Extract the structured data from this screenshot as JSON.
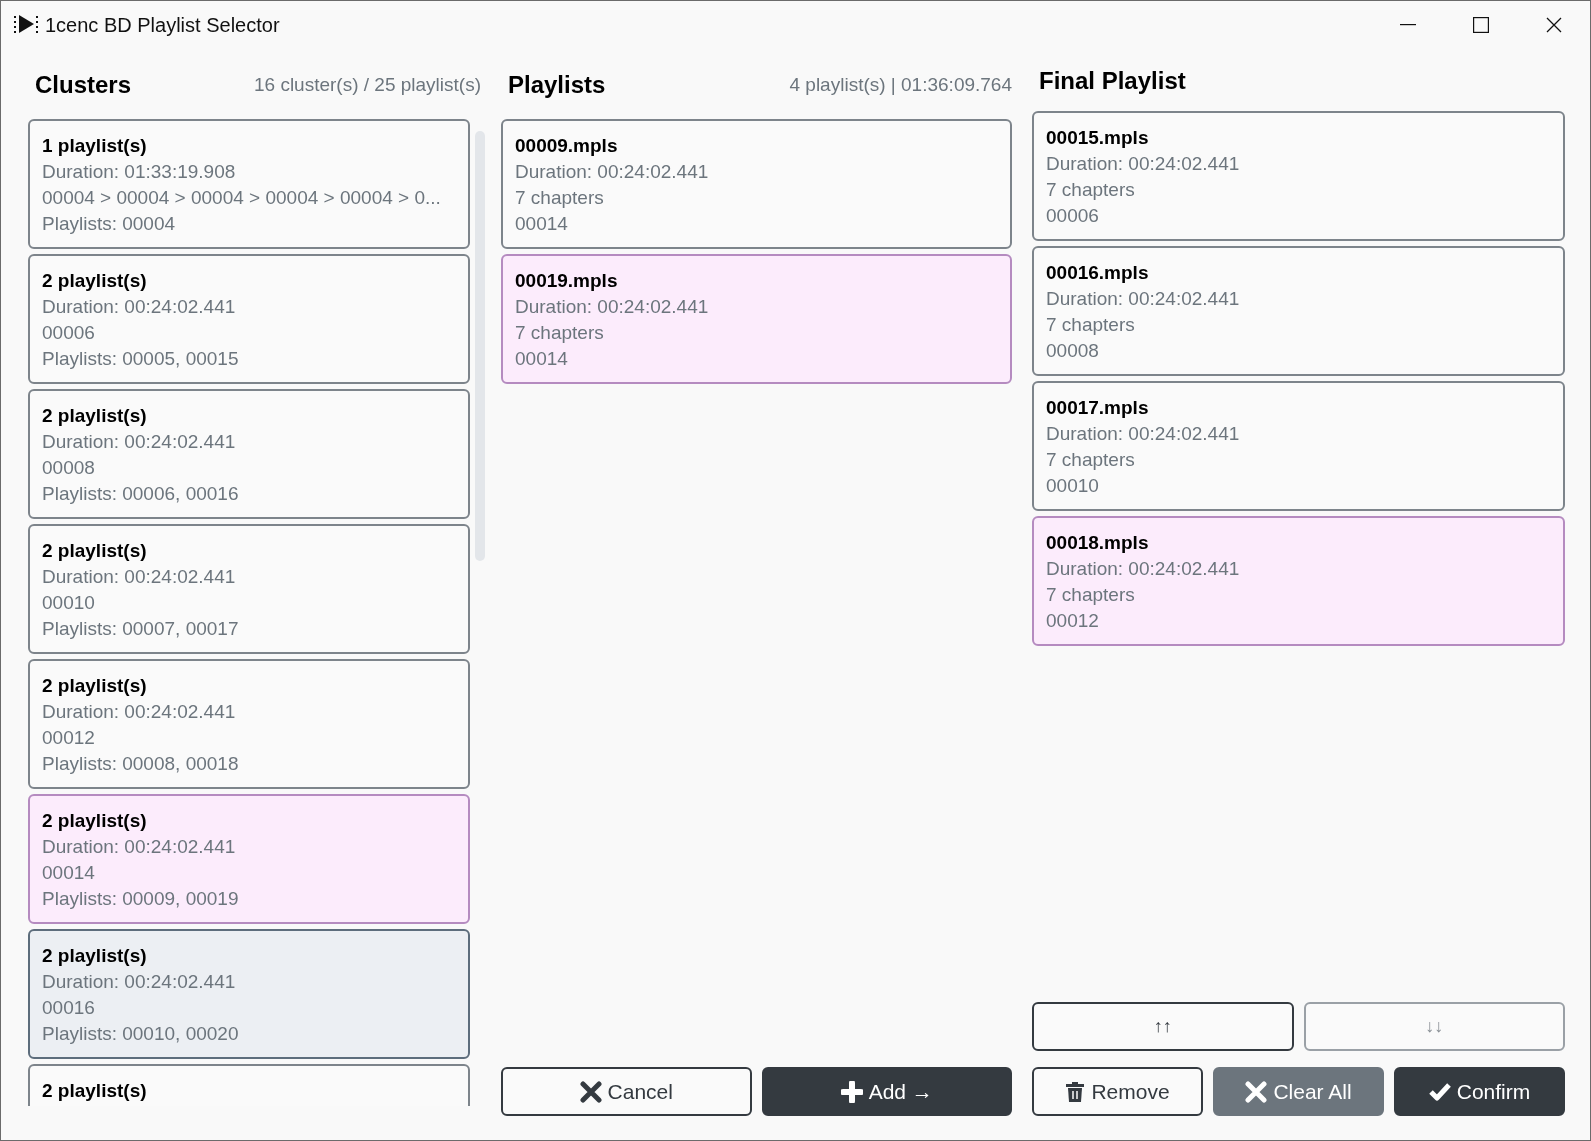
{
  "window": {
    "title": "1cenc BD Playlist Selector"
  },
  "clusters": {
    "heading": "Clusters",
    "summary": "16 cluster(s) / 25 playlist(s)",
    "items": [
      {
        "title": "1 playlist(s)",
        "lines": [
          "Duration: 01:33:19.908",
          "00004 > 00004 > 00004 > 00004 > 00004 > 0...",
          "Playlists: 00004"
        ],
        "selected": false,
        "hovered": false
      },
      {
        "title": "2 playlist(s)",
        "lines": [
          "Duration: 00:24:02.441",
          "00006",
          "Playlists: 00005, 00015"
        ],
        "selected": false,
        "hovered": false
      },
      {
        "title": "2 playlist(s)",
        "lines": [
          "Duration: 00:24:02.441",
          "00008",
          "Playlists: 00006, 00016"
        ],
        "selected": false,
        "hovered": false
      },
      {
        "title": "2 playlist(s)",
        "lines": [
          "Duration: 00:24:02.441",
          "00010",
          "Playlists: 00007, 00017"
        ],
        "selected": false,
        "hovered": false
      },
      {
        "title": "2 playlist(s)",
        "lines": [
          "Duration: 00:24:02.441",
          "00012",
          "Playlists: 00008, 00018"
        ],
        "selected": false,
        "hovered": false
      },
      {
        "title": "2 playlist(s)",
        "lines": [
          "Duration: 00:24:02.441",
          "00014",
          "Playlists: 00009, 00019"
        ],
        "selected": true,
        "hovered": false
      },
      {
        "title": "2 playlist(s)",
        "lines": [
          "Duration: 00:24:02.441",
          "00016",
          "Playlists: 00010, 00020"
        ],
        "selected": false,
        "hovered": true
      },
      {
        "title": "2 playlist(s)",
        "selected": false,
        "hovered": false
      }
    ]
  },
  "playlists": {
    "heading": "Playlists",
    "summary": "4 playlist(s) | 01:36:09.764",
    "items": [
      {
        "title": "00009.mpls",
        "lines": [
          "Duration: 00:24:02.441",
          "7 chapters",
          "00014"
        ],
        "selected": false
      },
      {
        "title": "00019.mpls",
        "lines": [
          "Duration: 00:24:02.441",
          "7 chapters",
          "00014"
        ],
        "selected": true
      }
    ],
    "buttons": [
      {
        "label": "Cancel"
      },
      {
        "label": "Add →"
      }
    ]
  },
  "final_playlist": {
    "heading": "Final Playlist",
    "items": [
      {
        "title": "00015.mpls",
        "lines": [
          "Duration: 00:24:02.441",
          "7 chapters",
          "00006"
        ],
        "selected": false
      },
      {
        "title": "00016.mpls",
        "lines": [
          "Duration: 00:24:02.441",
          "7 chapters",
          "00008"
        ],
        "selected": false
      },
      {
        "title": "00017.mpls",
        "lines": [
          "Duration: 00:24:02.441",
          "7 chapters",
          "00010"
        ],
        "selected": false
      },
      {
        "title": "00018.mpls",
        "lines": [
          "Duration: 00:24:02.441",
          "7 chapters",
          "00012"
        ],
        "selected": true
      }
    ],
    "move_buttons": [
      {
        "label": "↑↑",
        "disabled": false
      },
      {
        "label": "↓↓",
        "disabled": true
      }
    ],
    "buttons": [
      {
        "label": "Remove"
      },
      {
        "label": "Clear All"
      },
      {
        "label": "Confirm"
      }
    ]
  }
}
